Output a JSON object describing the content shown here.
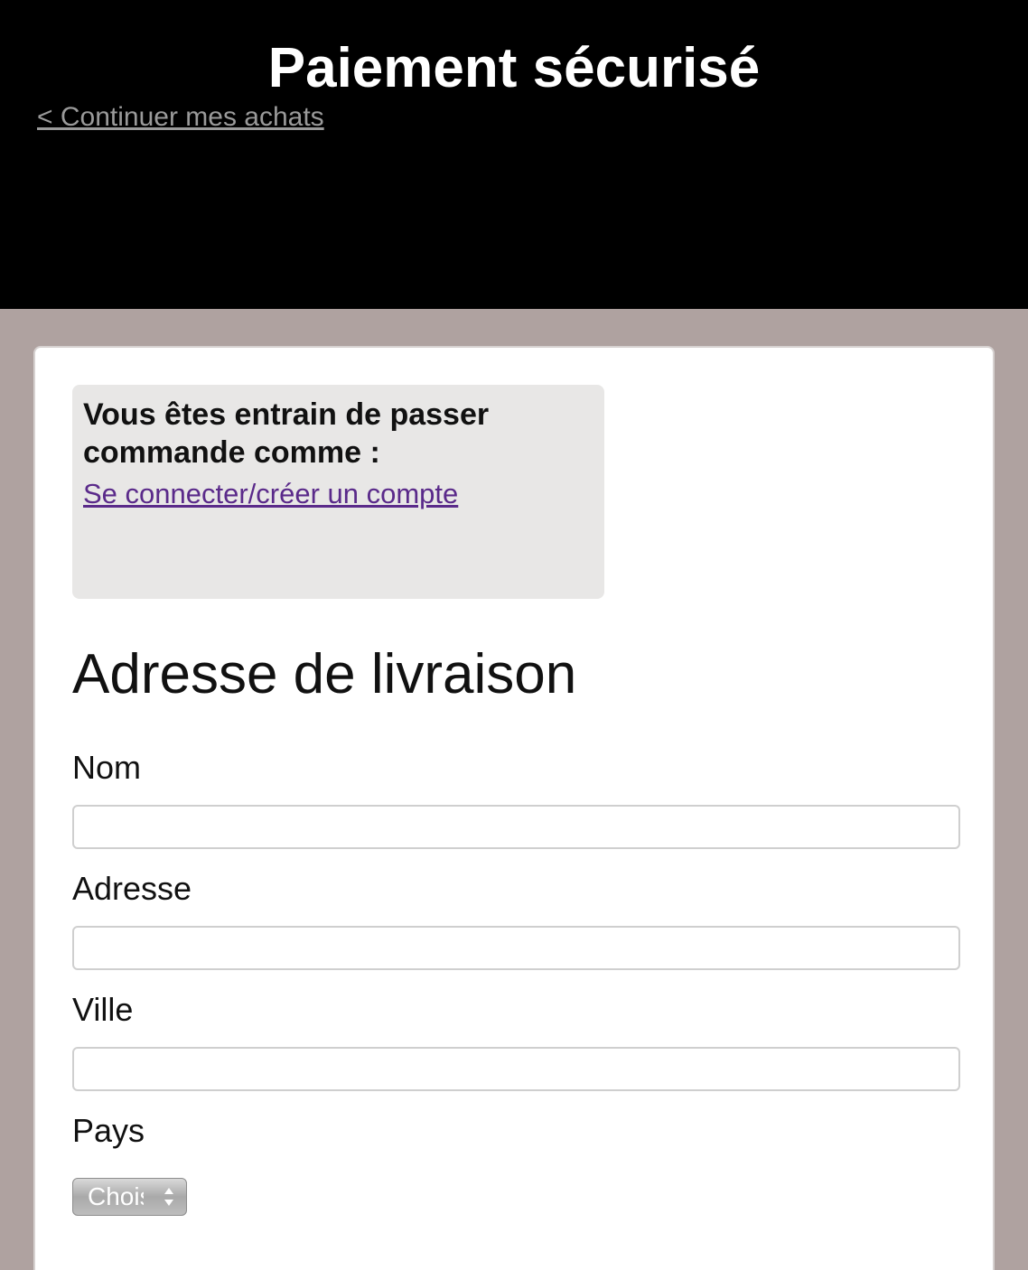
{
  "header": {
    "title": "Paiement sécurisé",
    "back_link": "< Continuer mes achats"
  },
  "account_box": {
    "heading": "Vous êtes entrain de passer commande comme :",
    "link": "Se connecter/créer un compte"
  },
  "shipping": {
    "title": "Adresse de livraison",
    "fields": {
      "name": {
        "label": "Nom",
        "value": ""
      },
      "address": {
        "label": "Adresse",
        "value": ""
      },
      "city": {
        "label": "Ville",
        "value": ""
      }
    },
    "country": {
      "label": "Pays",
      "selected": "Choisir"
    }
  },
  "icons": {
    "select_arrows": "chevron-up-down-icon"
  },
  "colors": {
    "header_bg": "#000000",
    "page_bg": "#afa2a0",
    "link_purple": "#5a2a8a",
    "box_bg": "#e8e7e6"
  }
}
